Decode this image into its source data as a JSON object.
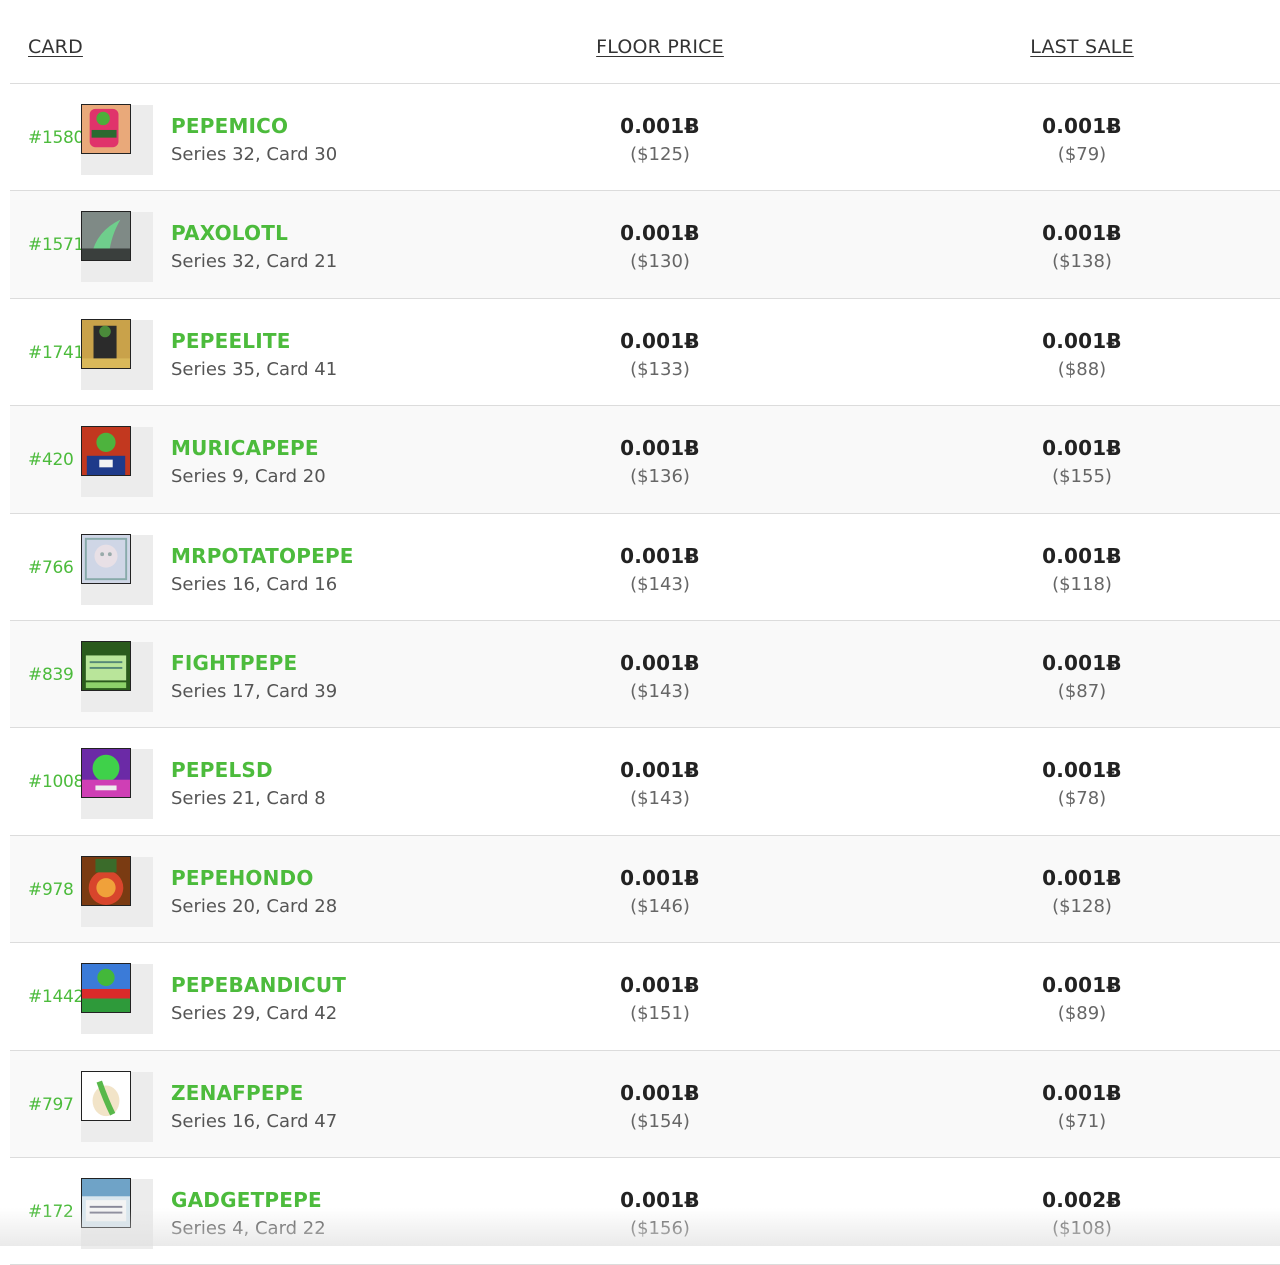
{
  "header": {
    "card": "CARD",
    "floor_price": "FLOOR PRICE",
    "last_sale": "LAST SALE"
  },
  "colors": {
    "accent": "#4cbb3c",
    "row_alt": "#f9f9f9",
    "divider": "#dcdcdc"
  },
  "rows": [
    {
      "rank": "#1580",
      "name": "PEPEMICO",
      "series": "Series 32, Card 30",
      "floor_btc": "0.001Ƀ",
      "floor_usd": "($125)",
      "last_btc": "0.001Ƀ",
      "last_usd": "($79)",
      "thumb_icon": "pepemico-card-icon"
    },
    {
      "rank": "#1571",
      "name": "PAXOLOTL",
      "series": "Series 32, Card 21",
      "floor_btc": "0.001Ƀ",
      "floor_usd": "($130)",
      "last_btc": "0.001Ƀ",
      "last_usd": "($138)",
      "thumb_icon": "paxolotl-card-icon"
    },
    {
      "rank": "#1741",
      "name": "PEPEELITE",
      "series": "Series 35, Card 41",
      "floor_btc": "0.001Ƀ",
      "floor_usd": "($133)",
      "last_btc": "0.001Ƀ",
      "last_usd": "($88)",
      "thumb_icon": "pepeelite-card-icon"
    },
    {
      "rank": "#420",
      "name": "MURICAPEPE",
      "series": "Series 9, Card 20",
      "floor_btc": "0.001Ƀ",
      "floor_usd": "($136)",
      "last_btc": "0.001Ƀ",
      "last_usd": "($155)",
      "thumb_icon": "muricapepe-card-icon"
    },
    {
      "rank": "#766",
      "name": "MRPOTATOPEPE",
      "series": "Series 16, Card 16",
      "floor_btc": "0.001Ƀ",
      "floor_usd": "($143)",
      "last_btc": "0.001Ƀ",
      "last_usd": "($118)",
      "thumb_icon": "mrpotatopepe-card-icon"
    },
    {
      "rank": "#839",
      "name": "FIGHTPEPE",
      "series": "Series 17, Card 39",
      "floor_btc": "0.001Ƀ",
      "floor_usd": "($143)",
      "last_btc": "0.001Ƀ",
      "last_usd": "($87)",
      "thumb_icon": "fightpepe-card-icon"
    },
    {
      "rank": "#1008",
      "name": "PEPELSD",
      "series": "Series 21, Card 8",
      "floor_btc": "0.001Ƀ",
      "floor_usd": "($143)",
      "last_btc": "0.001Ƀ",
      "last_usd": "($78)",
      "thumb_icon": "pepelsd-card-icon"
    },
    {
      "rank": "#978",
      "name": "PEPEHONDO",
      "series": "Series 20, Card 28",
      "floor_btc": "0.001Ƀ",
      "floor_usd": "($146)",
      "last_btc": "0.001Ƀ",
      "last_usd": "($128)",
      "thumb_icon": "pepehondo-card-icon"
    },
    {
      "rank": "#1442",
      "name": "PEPEBANDICUT",
      "series": "Series 29, Card 42",
      "floor_btc": "0.001Ƀ",
      "floor_usd": "($151)",
      "last_btc": "0.001Ƀ",
      "last_usd": "($89)",
      "thumb_icon": "pepebandicut-card-icon"
    },
    {
      "rank": "#797",
      "name": "ZENAFPEPE",
      "series": "Series 16, Card 47",
      "floor_btc": "0.001Ƀ",
      "floor_usd": "($154)",
      "last_btc": "0.001Ƀ",
      "last_usd": "($71)",
      "thumb_icon": "zenafpepe-card-icon"
    },
    {
      "rank": "#172",
      "name": "GADGETPEPE",
      "series": "Series 4, Card 22",
      "floor_btc": "0.001Ƀ",
      "floor_usd": "($156)",
      "last_btc": "0.002Ƀ",
      "last_usd": "($108)",
      "thumb_icon": "gadgetpepe-card-icon"
    }
  ]
}
